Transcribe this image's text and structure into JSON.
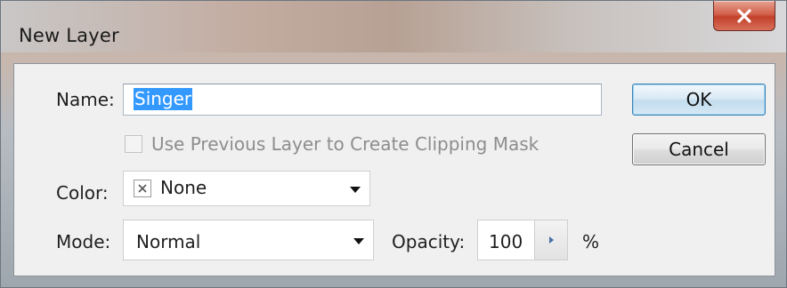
{
  "window": {
    "title": "New Layer",
    "close_icon": "close-x-icon"
  },
  "form": {
    "name_label": "Name:",
    "name_value": "Singer",
    "clipping_label": "Use Previous Layer to Create Clipping Mask",
    "clipping_checked": false,
    "clipping_enabled": false,
    "color_label": "Color:",
    "color_value": "None",
    "color_swatch_icon": "no-color-x-icon",
    "mode_label": "Mode:",
    "mode_value": "Normal",
    "opacity_label": "Opacity:",
    "opacity_value": "100",
    "opacity_unit": "%"
  },
  "buttons": {
    "ok_label": "OK",
    "cancel_label": "Cancel"
  },
  "colors": {
    "selection_highlight": "#3399ff",
    "close_button": "#c2402a",
    "ok_border": "#3c7fb1",
    "dialog_background": "#f0f0f0"
  }
}
